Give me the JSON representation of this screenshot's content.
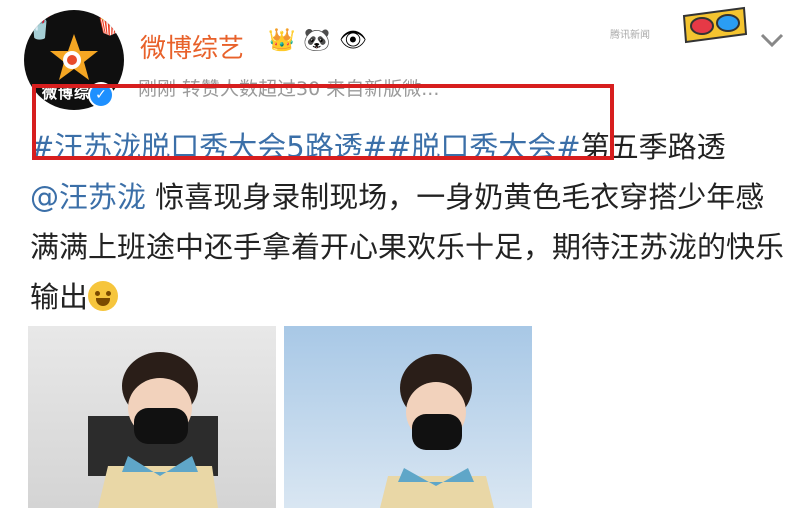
{
  "account": {
    "name": "微博综艺",
    "avatar_text": "微博综艺",
    "badges": [
      "crown-icon",
      "panda-icon",
      "eye-icon"
    ],
    "meta": "刚刚 转赞人数超过30  来自新版微..."
  },
  "post": {
    "tag1": "#汪苏泷脱口秀大会5路透#",
    "tag2": "#脱口秀大会#",
    "text1": "第五季路透",
    "mention": "@汪苏泷",
    "text2": " 惊喜现身录制现场，一身奶黄色毛衣穿搭少年感满满上班途中还手拿着开心果欢乐十足，期待汪苏泷的快乐输出"
  },
  "watermark": {
    "text": "腾讯新闻"
  },
  "colors": {
    "accent_name": "#e8612a",
    "link": "#3b6fa8",
    "highlight_box": "#d71e1e"
  }
}
